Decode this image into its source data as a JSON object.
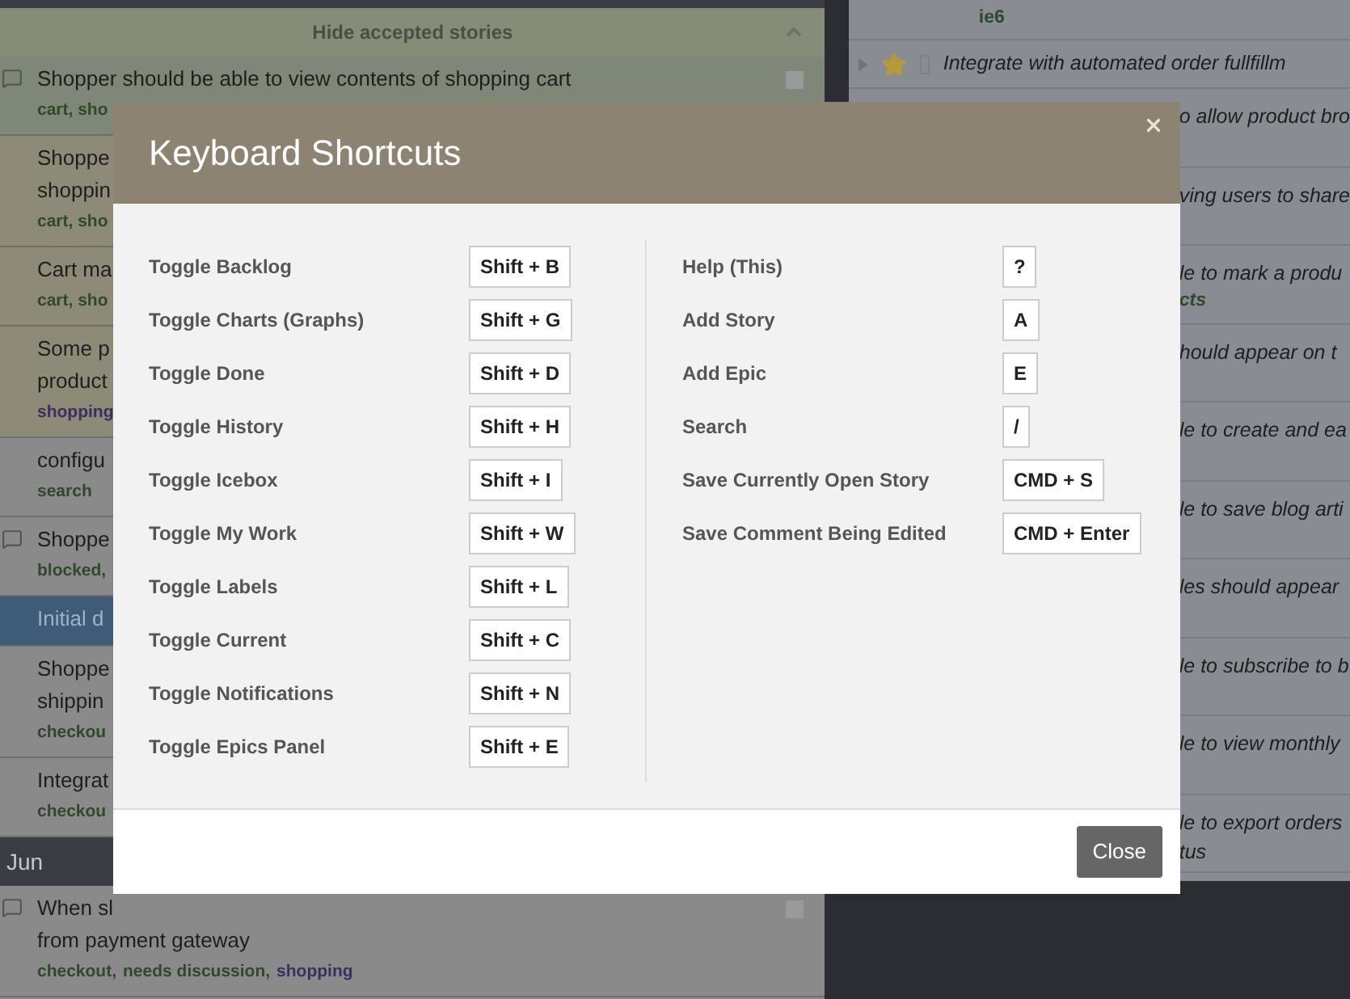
{
  "backlog": {
    "toggle": "Hide accepted stories",
    "rows": [
      {
        "kind": "accepted",
        "comment": true,
        "checked": false,
        "lines": [
          "Shopper should be able to view contents of shopping cart"
        ],
        "tags": [
          {
            "text": "cart, sho",
            "color": "#2f4a2a"
          }
        ]
      },
      {
        "kind": "delivered",
        "lines": [
          "Shoppe",
          "shoppin"
        ],
        "tags": [
          {
            "text": "cart, sho",
            "color": "#2f4a2a"
          }
        ]
      },
      {
        "kind": "delivered",
        "lines": [
          "Cart ma"
        ],
        "tags": [
          {
            "text": "cart, sho",
            "color": "#2f4a2a"
          }
        ]
      },
      {
        "kind": "delivered",
        "lines": [
          "Some p",
          "product"
        ],
        "tags": [
          {
            "text": "shopping",
            "color": "#3a2f5e"
          }
        ]
      },
      {
        "kind": "unstarted",
        "lines": [
          "configu"
        ],
        "tags": [
          {
            "text": "search",
            "color": "#2f4a2a"
          }
        ]
      },
      {
        "kind": "unstarted",
        "comment": true,
        "lines": [
          "Shoppe"
        ],
        "tags": [
          {
            "text": "blocked,",
            "color": "#2f4a2a"
          }
        ]
      },
      {
        "kind": "epic",
        "lines": [
          "Initial d"
        ],
        "tags": []
      },
      {
        "kind": "unstarted",
        "lines": [
          "Shoppe",
          "shippin"
        ],
        "tags": [
          {
            "text": "checkou",
            "color": "#2f4a2a"
          }
        ]
      },
      {
        "kind": "unstarted",
        "lines": [
          "Integrat"
        ],
        "tags": [
          {
            "text": "checkou",
            "color": "#2f4a2a"
          }
        ]
      },
      {
        "kind": "header",
        "lines": [
          "Jun"
        ],
        "tags": []
      },
      {
        "kind": "unstarted",
        "comment": true,
        "checked": false,
        "lines": [
          "When sl",
          "from payment gateway"
        ],
        "tags": [
          {
            "text": "checkout,",
            "color": "#2f4a2a"
          },
          {
            "text": "needs discussion,",
            "color": "#2f4a2a"
          },
          {
            "text": "shopping",
            "color": "#3a2f5e"
          }
        ]
      }
    ]
  },
  "icebox": {
    "rows": [
      {
        "kind": "tags",
        "text": "ie6"
      },
      {
        "kind": "story",
        "text": "Integrate with automated order fullfillm"
      },
      {
        "kind": "partial",
        "text": "o allow product bro"
      },
      {
        "kind": "partial",
        "text": "ving users to share"
      },
      {
        "kind": "partial",
        "text": "le to mark a produ",
        "tag": "cts"
      },
      {
        "kind": "partial",
        "text": "hould appear on t"
      },
      {
        "kind": "partial",
        "text": "le to create and ea"
      },
      {
        "kind": "partial",
        "text": "le to save blog arti"
      },
      {
        "kind": "partial",
        "text": "les should appear"
      },
      {
        "kind": "partial",
        "text": "le to subscribe to b"
      },
      {
        "kind": "partial",
        "text": "le to view monthly"
      },
      {
        "kind": "partial",
        "text": "le to export orders",
        "line2": "tus"
      }
    ]
  },
  "dialog": {
    "title": "Keyboard Shortcuts",
    "columns": [
      [
        {
          "action": "Toggle Backlog",
          "keys": "Shift + B"
        },
        {
          "action": "Toggle Charts (Graphs)",
          "keys": "Shift + G"
        },
        {
          "action": "Toggle Done",
          "keys": "Shift + D"
        },
        {
          "action": "Toggle History",
          "keys": "Shift + H"
        },
        {
          "action": "Toggle Icebox",
          "keys": "Shift + I"
        },
        {
          "action": "Toggle My Work",
          "keys": "Shift + W"
        },
        {
          "action": "Toggle Labels",
          "keys": "Shift + L"
        },
        {
          "action": "Toggle Current",
          "keys": "Shift + C"
        },
        {
          "action": "Toggle Notifications",
          "keys": "Shift + N"
        },
        {
          "action": "Toggle Epics Panel",
          "keys": "Shift + E"
        }
      ],
      [
        {
          "action": "Help (This)",
          "keys": "?"
        },
        {
          "action": "Add Story",
          "keys": "A"
        },
        {
          "action": "Add Epic",
          "keys": "E"
        },
        {
          "action": "Search",
          "keys": "/"
        },
        {
          "action": "Save Currently Open Story",
          "keys": "CMD + S"
        },
        {
          "action": "Save Comment Being Edited",
          "keys": "CMD + Enter"
        }
      ]
    ],
    "close_button": "Close"
  }
}
